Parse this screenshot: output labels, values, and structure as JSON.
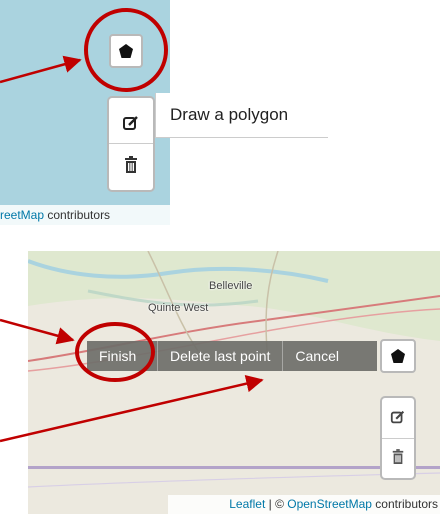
{
  "top_panel": {
    "attribution": {
      "link_text": "reetMap",
      "suffix": " contributors"
    },
    "tooltip": "Draw a polygon",
    "tools": {
      "draw": "pentagon-icon",
      "edit": "edit-icon",
      "delete": "trash-icon"
    }
  },
  "bottom_panel": {
    "places": {
      "belleville": "Belleville",
      "quinte_west": "Quinte West"
    },
    "actions": {
      "finish": "Finish",
      "delete_last": "Delete last point",
      "cancel": "Cancel"
    },
    "attribution": {
      "leaflet": "Leaflet",
      "sep": " | © ",
      "osm": "OpenStreetMap",
      "suffix": " contributors"
    }
  },
  "colors": {
    "callout": "#c00000",
    "water": "#aad3df",
    "link": "#0078a8"
  }
}
